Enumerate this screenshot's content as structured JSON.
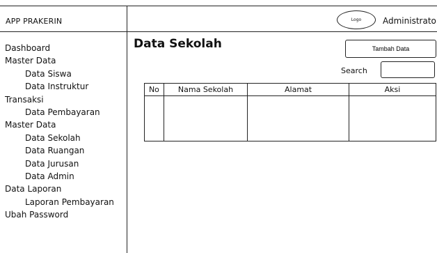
{
  "app": {
    "title": "APP PRAKERIN"
  },
  "header": {
    "logo_label": "Logo",
    "user_label": "Administrator"
  },
  "sidebar": {
    "items": [
      {
        "label": "Dashboard",
        "level": 0
      },
      {
        "label": "Master Data",
        "level": 0
      },
      {
        "label": "Data Siswa",
        "level": 1
      },
      {
        "label": "Data Instruktur",
        "level": 1
      },
      {
        "label": "Transaksi",
        "level": 0
      },
      {
        "label": "Data Pembayaran",
        "level": 1
      },
      {
        "label": "Master Data",
        "level": 0
      },
      {
        "label": "Data Sekolah",
        "level": 1
      },
      {
        "label": "Data Ruangan",
        "level": 1
      },
      {
        "label": "Data Jurusan",
        "level": 1
      },
      {
        "label": "Data Admin",
        "level": 1
      },
      {
        "label": "Data Laporan",
        "level": 0
      },
      {
        "label": "Laporan Pembayaran",
        "level": 1
      },
      {
        "label": "Ubah Password",
        "level": 0
      }
    ]
  },
  "main": {
    "title": "Data Sekolah",
    "add_button": "Tambah Data",
    "search_label": "Search",
    "search_value": "",
    "table": {
      "headers": [
        "No",
        "Nama Sekolah",
        "Alamat",
        "Aksi"
      ],
      "rows": [
        [
          "",
          "",
          "",
          ""
        ]
      ]
    }
  }
}
